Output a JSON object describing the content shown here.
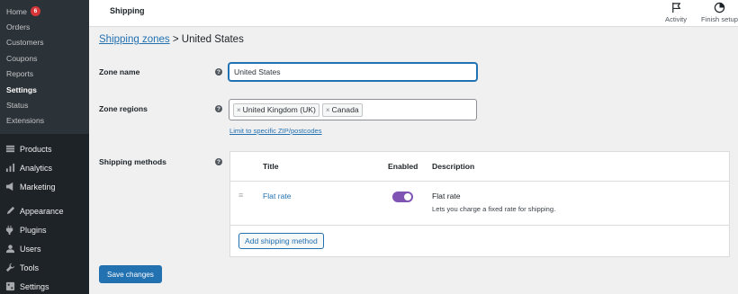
{
  "sidebar": {
    "sub_items": [
      {
        "label": "Home",
        "badge": "6"
      },
      {
        "label": "Orders"
      },
      {
        "label": "Customers"
      },
      {
        "label": "Coupons"
      },
      {
        "label": "Reports"
      },
      {
        "label": "Settings",
        "active": true
      },
      {
        "label": "Status"
      },
      {
        "label": "Extensions"
      }
    ],
    "menu": [
      {
        "label": "Products",
        "icon": "products-icon"
      },
      {
        "label": "Analytics",
        "icon": "analytics-icon"
      },
      {
        "label": "Marketing",
        "icon": "marketing-icon"
      },
      {
        "label": "Appearance",
        "icon": "appearance-icon"
      },
      {
        "label": "Plugins",
        "icon": "plugins-icon"
      },
      {
        "label": "Users",
        "icon": "users-icon"
      },
      {
        "label": "Tools",
        "icon": "tools-icon"
      },
      {
        "label": "Settings",
        "icon": "settings-icon"
      }
    ]
  },
  "header": {
    "title": "Shipping",
    "activity_label": "Activity",
    "finish_setup_label": "Finish setup"
  },
  "breadcrumb": {
    "link": "Shipping zones",
    "separator": ">",
    "current": "United States"
  },
  "form": {
    "zone_name_label": "Zone name",
    "zone_name_value": "United States",
    "zone_regions_label": "Zone regions",
    "regions": [
      "United Kingdom (UK)",
      "Canada"
    ],
    "limit_link": "Limit to specific ZIP/postcodes",
    "shipping_methods_label": "Shipping methods",
    "help_glyph": "?"
  },
  "methods_table": {
    "headers": {
      "title": "Title",
      "enabled": "Enabled",
      "description": "Description"
    },
    "rows": [
      {
        "title": "Flat rate",
        "enabled": true,
        "desc_title": "Flat rate",
        "desc_text": "Lets you charge a fixed rate for shipping."
      }
    ],
    "add_button": "Add shipping method"
  },
  "save_button": "Save changes",
  "colors": {
    "sidebar_bg": "#1d2327",
    "link": "#2271b1",
    "toggle_on": "#7f54b3",
    "badge": "#d63638"
  }
}
